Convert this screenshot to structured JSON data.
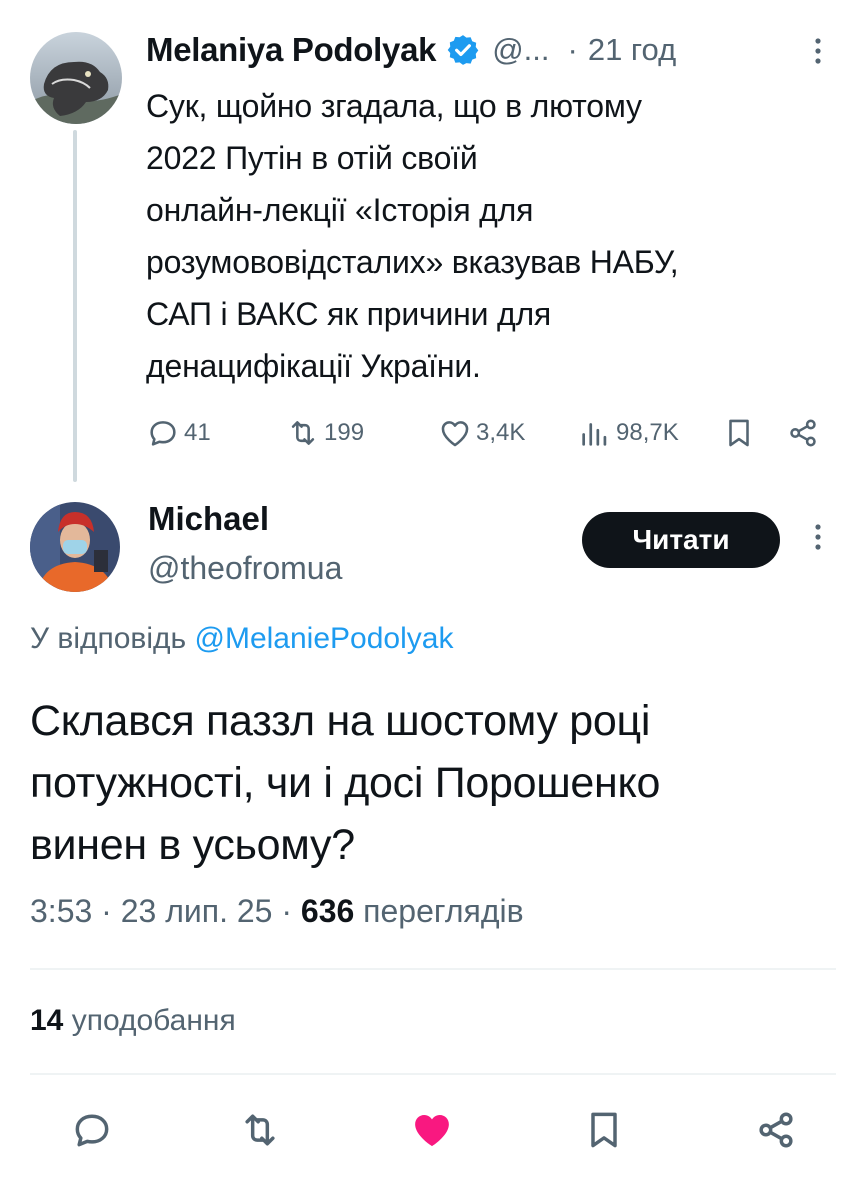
{
  "parent_tweet": {
    "author_name": "Melaniya Podolyak",
    "author_handle": "@...",
    "separator": "·",
    "time": "21 год",
    "text": "Сук, щойно згадала, що в лютому\n2022 Путін в отій своїй\nонлайн-лекції «Історія для\nрозумововідсталих» вказував НАБУ,\nСАП і ВАКС як причини для\nденацифікації України.",
    "replies": "41",
    "retweets": "199",
    "likes": "3,4K",
    "views": "98,7K"
  },
  "reply_tweet": {
    "author_name": "Michael",
    "author_handle": "@theofromua",
    "follow_label": "Читати",
    "reply_prefix": "У відповідь",
    "reply_mention": "@MelaniePodolyak",
    "text": "Склався паззл на шостому році\nпотужності, чи і досі Порошенко\nвинен в усьому?",
    "time": "3:53",
    "date": "23 лип. 25",
    "views_count": "636",
    "views_label": "переглядів",
    "likes_count": "14",
    "likes_label": "уподобання"
  },
  "colors": {
    "text_primary": "#0f1419",
    "text_secondary": "#536471",
    "accent_blue": "#1d9bf0",
    "like_pink": "#f91880",
    "divider": "#eff3f4"
  },
  "icons": {
    "reply": "reply-icon",
    "retweet": "retweet-icon",
    "like": "heart-icon",
    "views": "views-icon",
    "bookmark": "bookmark-icon",
    "share": "share-icon",
    "more": "more-vertical-icon",
    "verified": "verified-badge-icon"
  }
}
